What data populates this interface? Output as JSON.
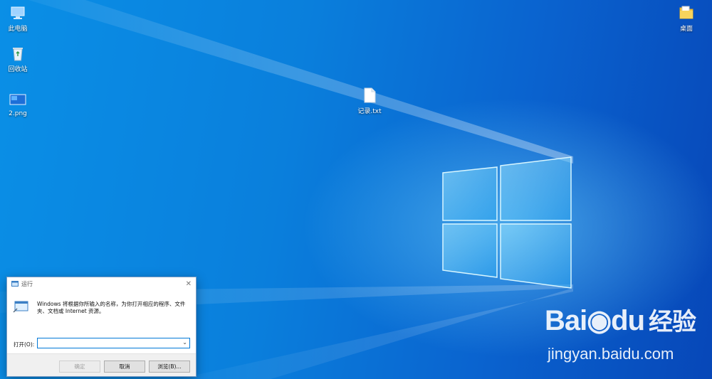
{
  "desktop": {
    "icons": [
      {
        "label": "此电脑",
        "icon": "computer-icon"
      },
      {
        "label": "回收站",
        "icon": "recycle-bin-icon"
      },
      {
        "label": "2.png",
        "icon": "image-file-icon"
      },
      {
        "label": "记录.txt",
        "icon": "text-file-icon"
      },
      {
        "label": "桌面",
        "icon": "folder-icon"
      }
    ]
  },
  "run_dialog": {
    "title": "运行",
    "close": "✕",
    "description": "Windows 将根据你所输入的名称，为你打开相应的程序、文件夹、文档或 Internet 资源。",
    "open_label": "打开(O):",
    "open_value": "",
    "buttons": {
      "ok": "确定",
      "cancel": "取消",
      "browse": "浏览(B)..."
    }
  },
  "watermark": {
    "brand": "Bai",
    "brand_suffix": "du",
    "brand_cn": "经验",
    "url": "jingyan.baidu.com"
  }
}
